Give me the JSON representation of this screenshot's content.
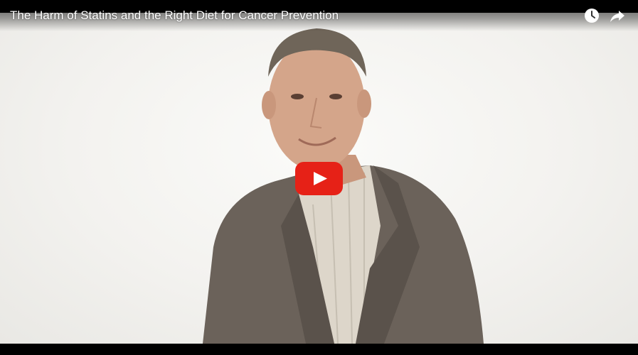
{
  "video": {
    "title": "The Harm of Statins and the Right Diet for Cancer Prevention"
  },
  "controls": {
    "watch_later_icon": "clock-icon",
    "share_icon": "share-arrow-icon",
    "play_icon": "youtube-play-icon"
  },
  "colors": {
    "play_red": "#e62117",
    "background": "#f3f2ef",
    "bar": "#000000"
  }
}
